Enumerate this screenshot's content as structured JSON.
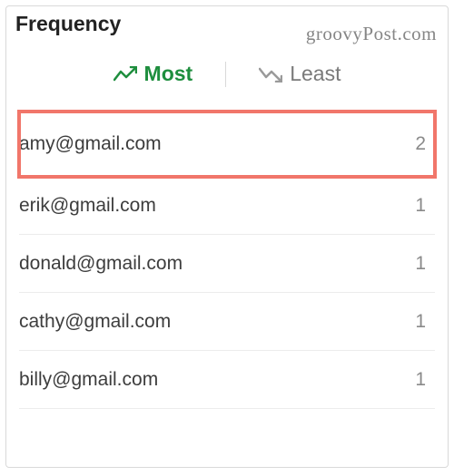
{
  "header": {
    "title": "Frequency"
  },
  "watermark": "groovyPost.com",
  "tabs": {
    "most_label": "Most",
    "least_label": "Least",
    "active": "most"
  },
  "rows": [
    {
      "email": "amy@gmail.com",
      "count": "2",
      "highlighted": true
    },
    {
      "email": "erik@gmail.com",
      "count": "1",
      "highlighted": false
    },
    {
      "email": "donald@gmail.com",
      "count": "1",
      "highlighted": false
    },
    {
      "email": "cathy@gmail.com",
      "count": "1",
      "highlighted": false
    },
    {
      "email": "billy@gmail.com",
      "count": "1",
      "highlighted": false
    }
  ]
}
